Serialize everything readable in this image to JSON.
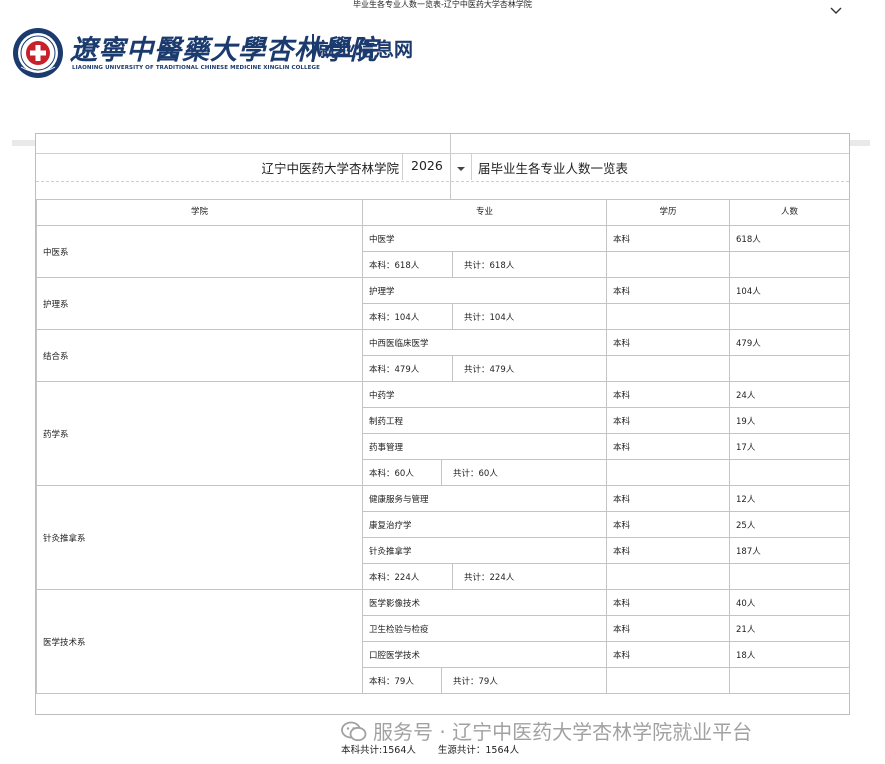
{
  "page_title": "毕业生各专业人数一览表-辽宁中医药大学杏林学院",
  "icons": {
    "expand": "chevron-down-icon",
    "emblem": "university-emblem",
    "wechat": "wechat-logo-icon",
    "dropdown": "caret-down-icon"
  },
  "header": {
    "calligraphy": "遼寧中醫藥大學杏林學院",
    "english_name": "LIAONING UNIVERSITY OF TRADITIONAL CHINESE MEDICINE XINGLIN COLLEGE",
    "site_name": "就业信息网",
    "brand_color": "#1b3a6e",
    "accent_color": "#c8202a"
  },
  "title_bar": {
    "college": "辽宁中医药大学杏林学院",
    "year": "2026",
    "suffix": "届毕业生各专业人数一览表"
  },
  "columns": [
    "学院",
    "专业",
    "学历",
    "人数"
  ],
  "departments": [
    {
      "name": "中医系",
      "majors": [
        {
          "major": "中医学",
          "level": "本科",
          "count": "618人"
        }
      ],
      "sum_undergrad": "本科：618人",
      "sum_total": "共计：618人"
    },
    {
      "name": "护理系",
      "majors": [
        {
          "major": "护理学",
          "level": "本科",
          "count": "104人"
        }
      ],
      "sum_undergrad": "本科：104人",
      "sum_total": "共计：104人"
    },
    {
      "name": "结合系",
      "majors": [
        {
          "major": "中西医临床医学",
          "level": "本科",
          "count": "479人"
        }
      ],
      "sum_undergrad": "本科：479人",
      "sum_total": "共计：479人"
    },
    {
      "name": "药学系",
      "majors": [
        {
          "major": "中药学",
          "level": "本科",
          "count": "24人"
        },
        {
          "major": "制药工程",
          "level": "本科",
          "count": "19人"
        },
        {
          "major": "药事管理",
          "level": "本科",
          "count": "17人"
        }
      ],
      "sum_undergrad": "本科：60人",
      "sum_total": "共计：60人"
    },
    {
      "name": "针灸推拿系",
      "majors": [
        {
          "major": "健康服务与管理",
          "level": "本科",
          "count": "12人"
        },
        {
          "major": "康复治疗学",
          "level": "本科",
          "count": "25人"
        },
        {
          "major": "针灸推拿学",
          "level": "本科",
          "count": "187人"
        }
      ],
      "sum_undergrad": "本科：224人",
      "sum_total": "共计：224人"
    },
    {
      "name": "医学技术系",
      "majors": [
        {
          "major": "医学影像技术",
          "level": "本科",
          "count": "40人"
        },
        {
          "major": "卫生检验与检疫",
          "level": "本科",
          "count": "21人"
        },
        {
          "major": "口腔医学技术",
          "level": "本科",
          "count": "18人"
        }
      ],
      "sum_undergrad": "本科：79人",
      "sum_total": "共计：79人"
    }
  ],
  "footer": {
    "undergrad_total": "本科共计:1564人",
    "grand_total": "生源共计：1564人"
  },
  "watermark": "服务号 · 辽宁中医药大学杏林学院就业平台"
}
